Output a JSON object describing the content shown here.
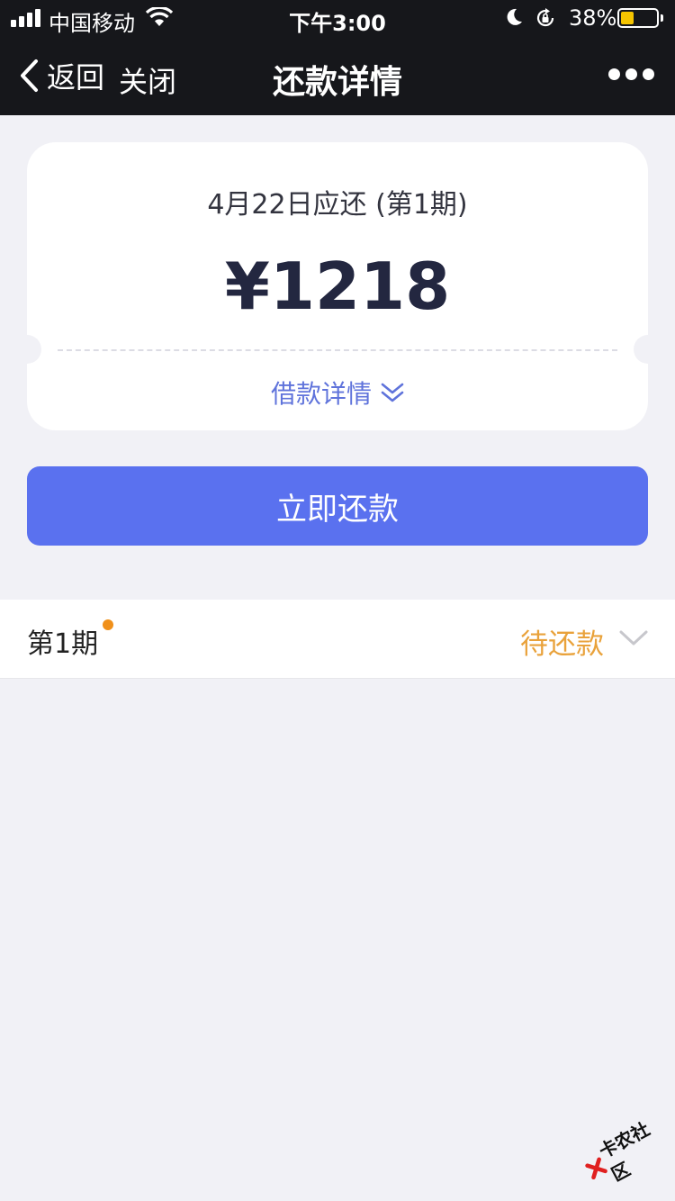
{
  "status_bar": {
    "carrier": "中国移动",
    "time": "下午3:00",
    "battery_percent_text": "38%",
    "battery_level": 0.38,
    "battery_color": "#f5c400"
  },
  "nav": {
    "back_label": "返回",
    "close_label": "关闭",
    "title": "还款详情",
    "more_icon": "more-dots-icon"
  },
  "card": {
    "due_label": "4月22日应还 (第1期)",
    "amount": "¥1218",
    "loan_detail_label": "借款详情",
    "loan_detail_icon": "double-chevron-down-icon"
  },
  "repay_button": {
    "label": "立即还款",
    "color": "#5a71ef"
  },
  "periods": [
    {
      "label": "第1期",
      "status": "待还款",
      "status_color": "#e9a23b",
      "has_dot": true
    }
  ],
  "watermark": {
    "text": "卡农社区"
  }
}
